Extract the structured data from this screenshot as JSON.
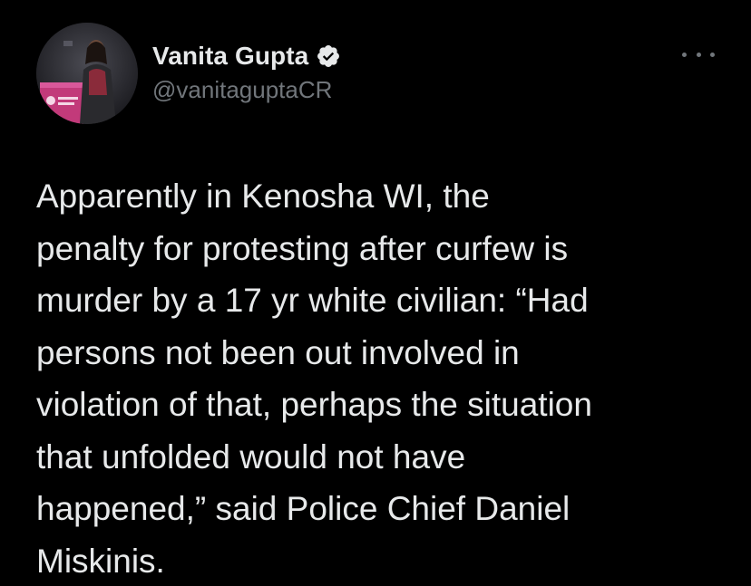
{
  "author": {
    "display_name": "Vanita Gupta",
    "handle": "@vanitaguptaCR",
    "verified": true,
    "avatar_icon": "profile-photo"
  },
  "tweet": {
    "text": "Apparently in Kenosha WI, the\npenalty for protesting after curfew is\nmurder by a 17 yr white civilian: “Had\npersons not been out involved in\nviolation of that, perhaps the situation\nthat unfolded would not have\nhappened,” said Police Chief Daniel\nMiskinis."
  },
  "menu": {
    "icon": "more-icon"
  },
  "colors": {
    "background": "#000000",
    "primary_text": "#e7e9ea",
    "secondary_text": "#71767b",
    "verified_badge": "#e7e9ea"
  }
}
